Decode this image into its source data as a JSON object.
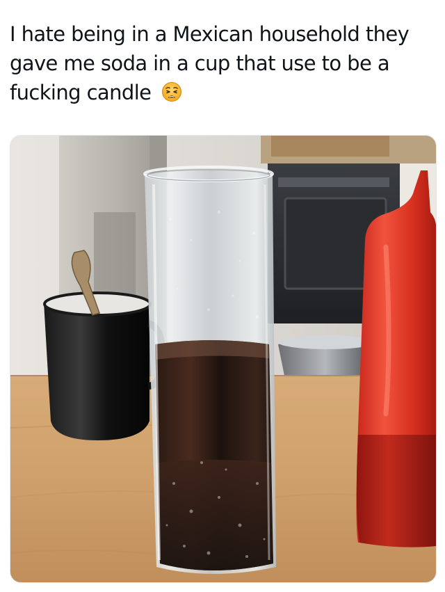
{
  "post": {
    "text": "I hate being in a Mexican household they gave me soda in a cup that use to be a fucking candle",
    "emoji_icon": "weary-face-emoji"
  },
  "media": {
    "icon": "photo-glass-candle-soda"
  }
}
